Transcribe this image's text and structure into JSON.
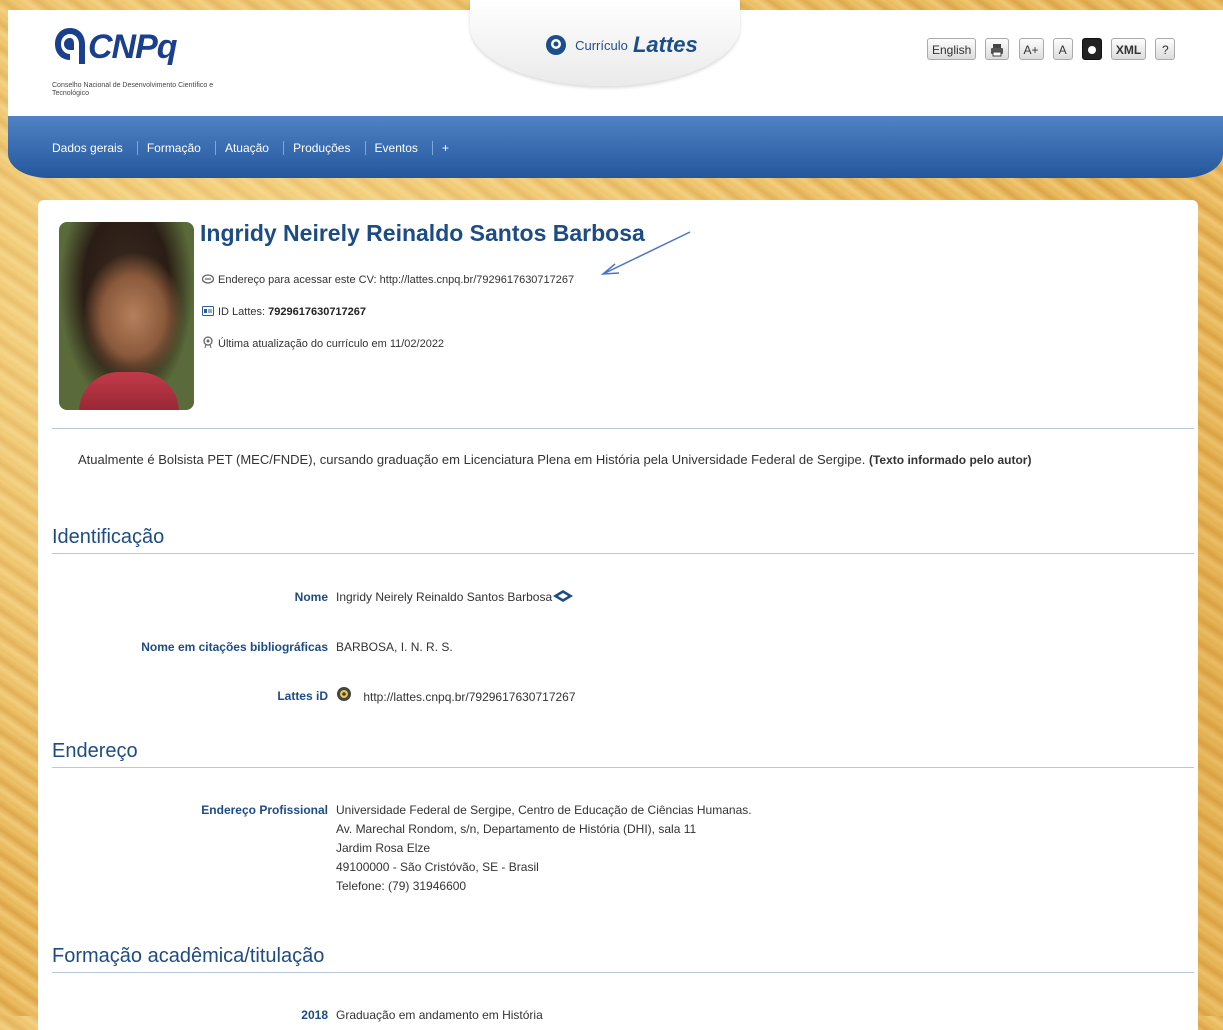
{
  "header": {
    "logo_text": "CNPq",
    "logo_subtitle": "Conselho Nacional de Desenvolvimento Científico e Tecnológico",
    "lattes_small": "Currículo",
    "lattes_big": "Lattes",
    "toolbar": {
      "english": "English",
      "font_plus": "A+",
      "font_normal": "A",
      "xml": "XML",
      "help": "?"
    }
  },
  "nav": {
    "items": [
      "Dados gerais",
      "Formação",
      "Atuação",
      "Produções",
      "Eventos",
      "+"
    ]
  },
  "profile": {
    "name": "Ingridy Neirely Reinaldo Santos Barbosa",
    "cv_address_label": "Endereço para acessar este CV:",
    "cv_address_url": "http://lattes.cnpq.br/7929617630717267",
    "id_label": "ID Lattes:",
    "id_value": "7929617630717267",
    "updated_label": "Última atualização do currículo em",
    "updated_date": "11/02/2022",
    "summary": "Atualmente é Bolsista PET (MEC/FNDE), cursando graduação em Licenciatura Plena em História pela Universidade Federal de Sergipe.",
    "summary_note": "(Texto informado pelo autor)"
  },
  "identificacao": {
    "title": "Identificação",
    "nome_label": "Nome",
    "nome_value": "Ingridy Neirely Reinaldo Santos Barbosa",
    "citacoes_label": "Nome em citações bibliográficas",
    "citacoes_value": "BARBOSA, I. N. R. S.",
    "lattes_id_label": "Lattes iD",
    "lattes_id_value": "http://lattes.cnpq.br/7929617630717267"
  },
  "endereco": {
    "title": "Endereço",
    "label": "Endereço Profissional",
    "lines": [
      "Universidade Federal de Sergipe, Centro de Educação de Ciências Humanas.",
      "Av. Marechal Rondom, s/n, Departamento de História (DHI), sala 11",
      "Jardim Rosa Elze",
      "49100000 - São Cristóvão, SE - Brasil",
      "Telefone: (79) 31946600"
    ]
  },
  "formacao": {
    "title": "Formação acadêmica/titulação",
    "year": "2018",
    "value": "Graduação em andamento em História"
  },
  "colors": {
    "accent_blue": "#1d4c84",
    "nav_blue": "#24569c",
    "background_gold": "#e8b555"
  }
}
